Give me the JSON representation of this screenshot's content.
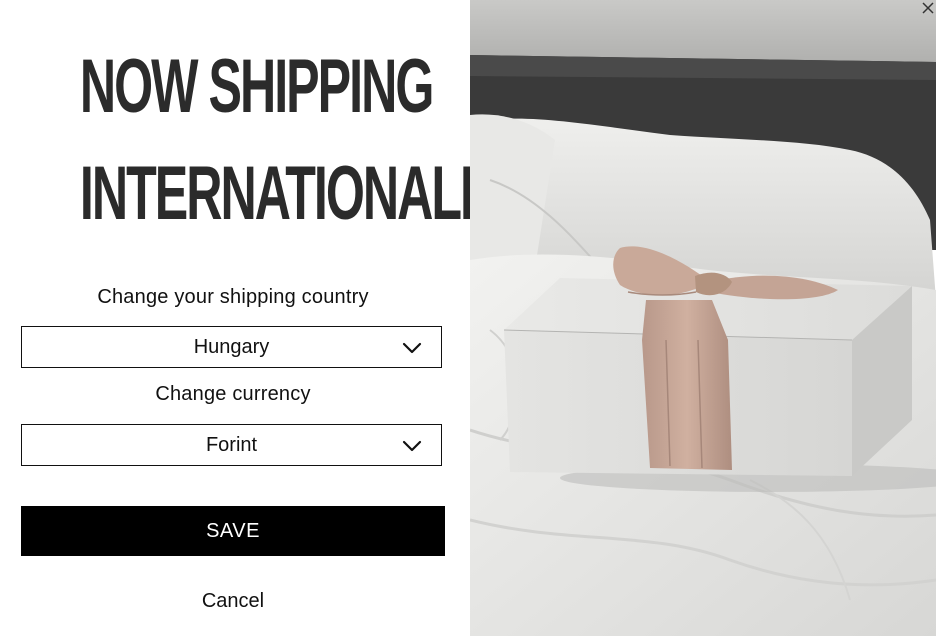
{
  "headline": {
    "line1": "NOW SHIPPING",
    "line2": "INTERNATIONALLY!"
  },
  "country": {
    "label": "Change your shipping country",
    "selected": "Hungary"
  },
  "currency": {
    "label": "Change currency",
    "selected": "Forint"
  },
  "actions": {
    "save_label": "SAVE",
    "cancel_label": "Cancel"
  },
  "icons": {
    "dropdown": "chevron-down-icon",
    "close": "close-icon"
  },
  "colors": {
    "headline": "#2b2b2b",
    "save_bg": "#000000",
    "save_text": "#ffffff",
    "ribbon": "#c9a999"
  }
}
